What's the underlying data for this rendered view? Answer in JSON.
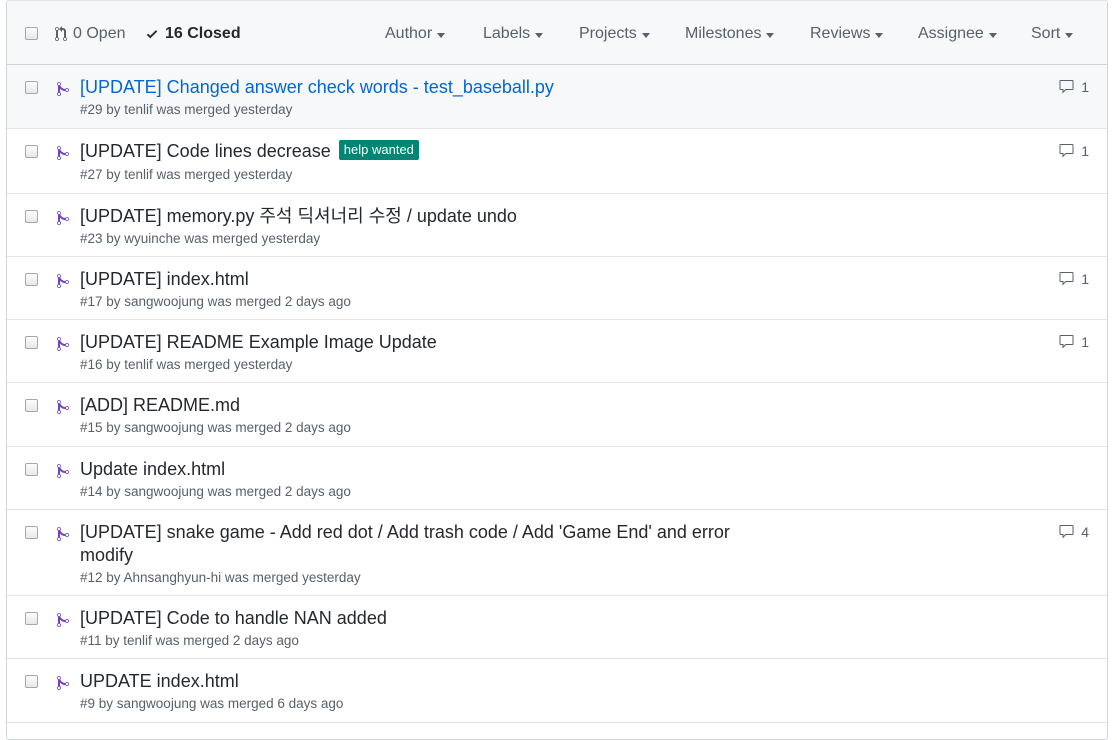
{
  "header": {
    "open_label": "0 Open",
    "closed_label": "16 Closed",
    "filters": {
      "author": "Author",
      "labels": "Labels",
      "projects": "Projects",
      "milestones": "Milestones",
      "reviews": "Reviews",
      "assignee": "Assignee",
      "sort": "Sort"
    }
  },
  "colors": {
    "merged_icon": "#6f42c1",
    "help_wanted_label": "#008672",
    "link": "#0366d6"
  },
  "prs": [
    {
      "title": "[UPDATE] Changed answer check words - test_baseball.py",
      "meta": "#29 by tenlif was merged yesterday",
      "comments": "1"
    },
    {
      "title": "[UPDATE] Code lines decrease",
      "label": "help wanted",
      "meta": "#27 by tenlif was merged yesterday",
      "comments": "1"
    },
    {
      "title": "[UPDATE] memory.py 주석 딕셔너리 수정 / update undo",
      "meta": "#23 by wyuinche was merged yesterday"
    },
    {
      "title": "[UPDATE] index.html",
      "meta": "#17 by sangwoojung was merged 2 days ago",
      "comments": "1"
    },
    {
      "title": "[UPDATE] README Example Image Update",
      "meta": "#16 by tenlif was merged yesterday",
      "comments": "1"
    },
    {
      "title": "[ADD] README.md",
      "meta": "#15 by sangwoojung was merged 2 days ago"
    },
    {
      "title": "Update index.html",
      "meta": "#14 by sangwoojung was merged 2 days ago"
    },
    {
      "title": "[UPDATE] snake game - Add red dot / Add trash code / Add 'Game End' and error modify",
      "meta": "#12 by Ahnsanghyun-hi was merged yesterday",
      "comments": "4"
    },
    {
      "title": "[UPDATE] Code to handle NAN added",
      "meta": "#11 by tenlif was merged 2 days ago"
    },
    {
      "title": "UPDATE index.html",
      "meta": "#9 by sangwoojung was merged 6 days ago"
    }
  ]
}
